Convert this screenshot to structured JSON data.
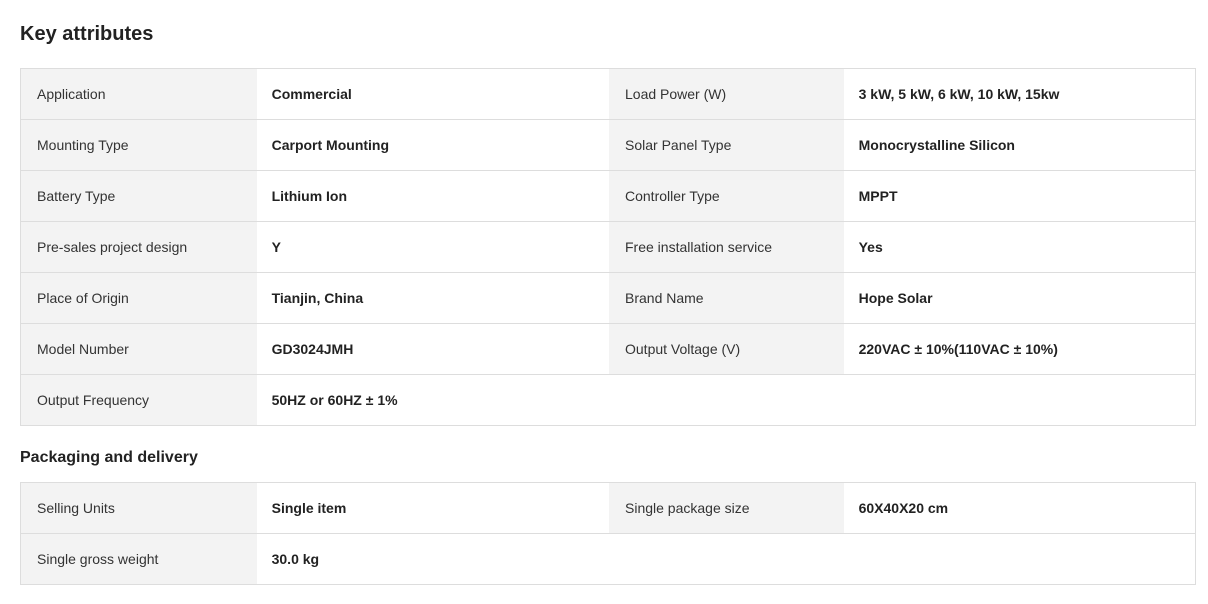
{
  "key_attributes": {
    "title": "Key attributes",
    "rows": [
      {
        "l1": "Application",
        "v1": "Commercial",
        "l2": "Load Power (W)",
        "v2": "3 kW, 5 kW, 6 kW, 10 kW, 15kw"
      },
      {
        "l1": "Mounting Type",
        "v1": "Carport Mounting",
        "l2": "Solar Panel Type",
        "v2": "Monocrystalline Silicon"
      },
      {
        "l1": "Battery Type",
        "v1": "Lithium Ion",
        "l2": "Controller Type",
        "v2": "MPPT"
      },
      {
        "l1": "Pre-sales project design",
        "v1": "Y",
        "l2": "Free installation service",
        "v2": "Yes"
      },
      {
        "l1": "Place of Origin",
        "v1": "Tianjin, China",
        "l2": "Brand Name",
        "v2": "Hope Solar"
      },
      {
        "l1": "Model Number",
        "v1": "GD3024JMH",
        "l2": "Output Voltage (V)",
        "v2": "220VAC ± 10%(110VAC ± 10%)"
      },
      {
        "l1": "Output Frequency",
        "v1": "50HZ or 60HZ ± 1%"
      }
    ]
  },
  "packaging": {
    "title": "Packaging and delivery",
    "rows": [
      {
        "l1": "Selling Units",
        "v1": "Single item",
        "l2": "Single package size",
        "v2": "60X40X20 cm"
      },
      {
        "l1": "Single gross weight",
        "v1": "30.0 kg"
      }
    ]
  }
}
